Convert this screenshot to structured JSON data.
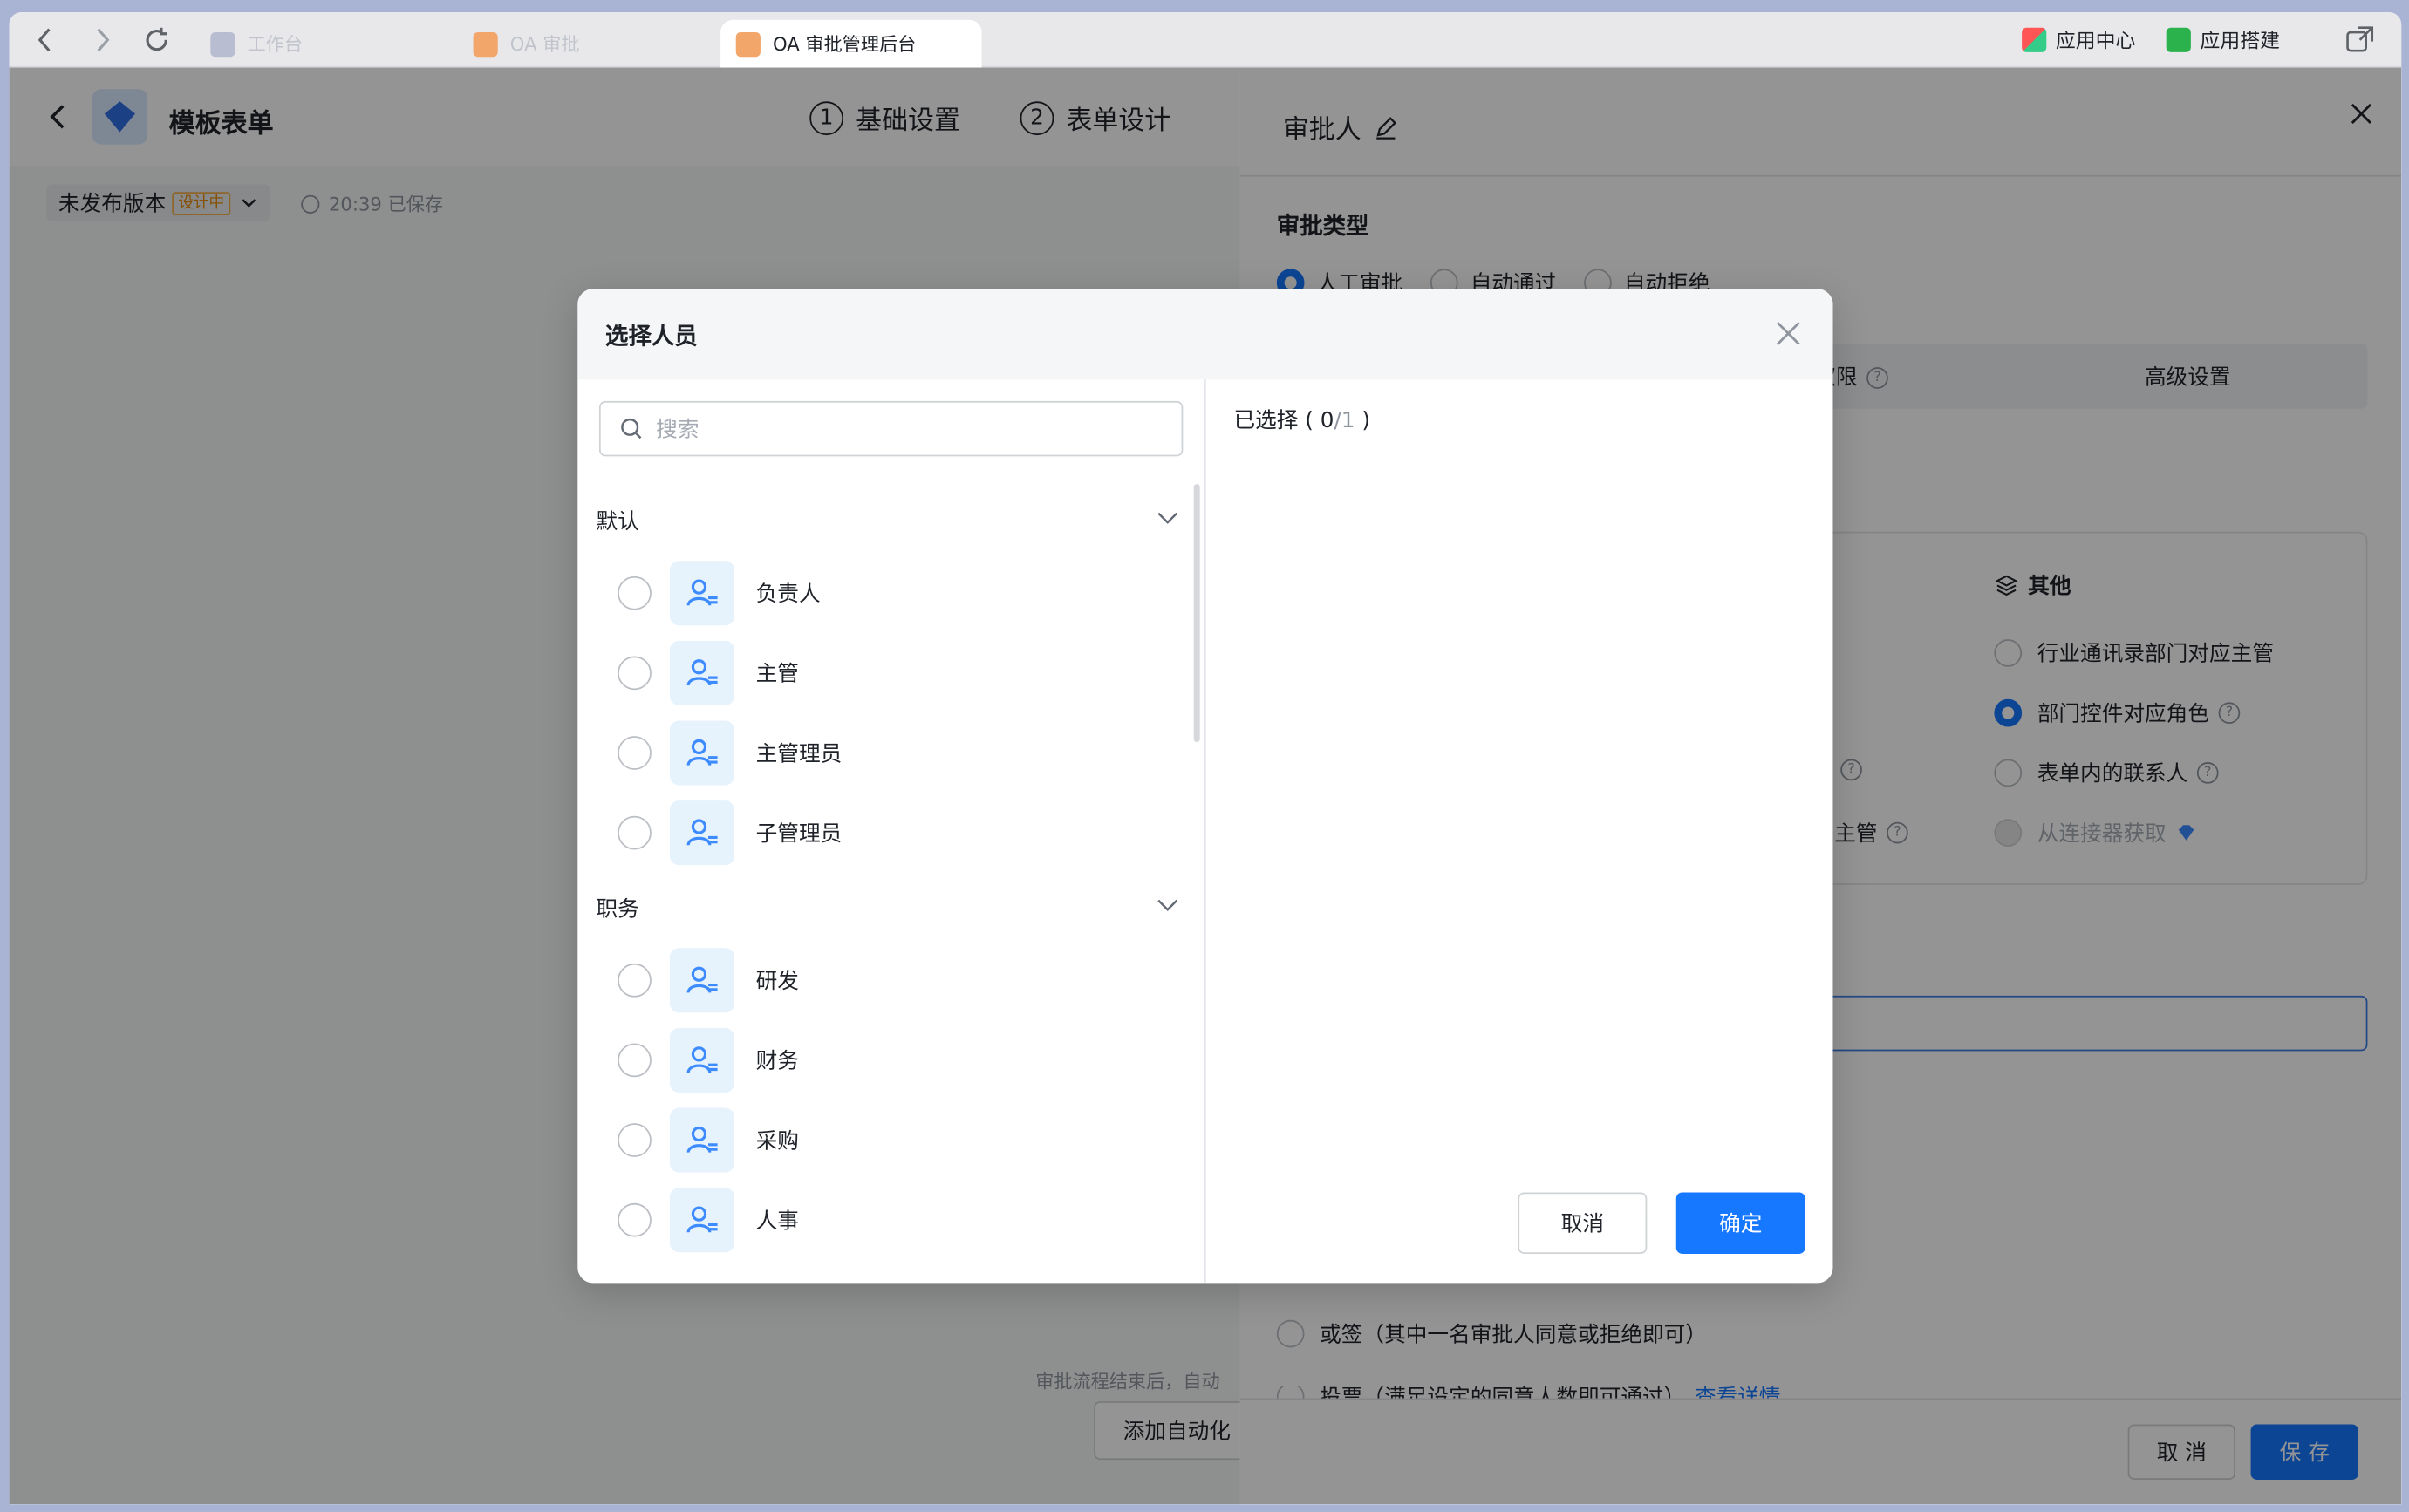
{
  "browser": {
    "tabs": [
      {
        "label": "工作台"
      },
      {
        "label": "OA 审批"
      },
      {
        "label": "OA 审批管理后台"
      }
    ],
    "right": {
      "app_center": "应用中心",
      "app_builder": "应用搭建"
    }
  },
  "page": {
    "title": "模板表单",
    "version": "未发布版本",
    "badge": "设计中",
    "saved": "20:39 已保存",
    "steps": [
      {
        "num": "1",
        "label": "基础设置"
      },
      {
        "num": "2",
        "label": "表单设计"
      }
    ],
    "bottom_hint": "审批流程结束后，自动",
    "add_automation": "添加自动化"
  },
  "drawer": {
    "title": "审批人",
    "approve_type_label": "审批类型",
    "approve_types": [
      "人工审批",
      "自动通过",
      "自动拒绝"
    ],
    "tabs": [
      "权限",
      "高级设置"
    ],
    "other_group": "其他",
    "other_options": [
      "行业通讯录部门对应主管",
      "部门控件对应角色",
      "表单内的联系人",
      "从连接器获取"
    ],
    "partial_label": "主管",
    "sign_mode": "或签（其中一名审批人同意或拒绝即可）",
    "vote_mode": "投票（满足设定的同意人数即可通过）",
    "vote_link": "查看详情",
    "cancel": "取 消",
    "save": "保 存"
  },
  "modal": {
    "title": "选择人员",
    "search_placeholder": "搜索",
    "groups": [
      {
        "name": "默认",
        "items": [
          "负责人",
          "主管",
          "主管理员",
          "子管理员"
        ]
      },
      {
        "name": "职务",
        "items": [
          "研发",
          "财务",
          "采购",
          "人事"
        ]
      }
    ],
    "selected_label": "已选择",
    "selected_count": "0",
    "selected_max": "1",
    "cancel": "取消",
    "confirm": "确定"
  }
}
